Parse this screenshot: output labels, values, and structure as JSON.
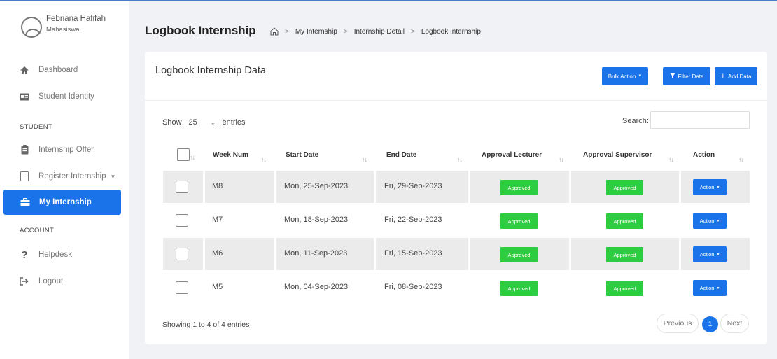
{
  "profile": {
    "name": "Febriana Hafifah",
    "role": "Mahasiswa"
  },
  "sidebar": {
    "items": [
      {
        "label": "Dashboard",
        "icon": "home-icon"
      },
      {
        "label": "Student Identity",
        "icon": "id-card-icon"
      },
      {
        "label": "Internship Offer",
        "icon": "clipboard-icon"
      },
      {
        "label": "Register Internship",
        "icon": "form-icon"
      },
      {
        "label": "My Internship",
        "icon": "briefcase-icon"
      },
      {
        "label": "Helpdesk",
        "icon": "question-icon"
      },
      {
        "label": "Logout",
        "icon": "logout-icon"
      }
    ],
    "sections": {
      "student": "STUDENT",
      "account": "ACCOUNT"
    }
  },
  "header": {
    "title": "Logbook Internship",
    "breadcrumb": [
      "My Internship",
      "Internship Detail",
      "Logbook Internship"
    ]
  },
  "card": {
    "title": "Logbook Internship Data",
    "buttons": {
      "bulk": "Bulk Action",
      "filter": "Filter Data",
      "add": "Add Data"
    },
    "show_label": "Show",
    "entries_value": "25",
    "entries_label": "entries",
    "search_label": "Search:",
    "search_value": ""
  },
  "table": {
    "headers": [
      "Week Num",
      "Start Date",
      "End Date",
      "Approval Lecturer",
      "Approval Supervisor",
      "Action"
    ],
    "rows": [
      {
        "week": "M8",
        "start": "Mon, 25-Sep-2023",
        "end": "Fri, 29-Sep-2023",
        "lecturer": "Approved",
        "supervisor": "Approved",
        "action": "Action"
      },
      {
        "week": "M7",
        "start": "Mon, 18-Sep-2023",
        "end": "Fri, 22-Sep-2023",
        "lecturer": "Approved",
        "supervisor": "Approved",
        "action": "Action"
      },
      {
        "week": "M6",
        "start": "Mon, 11-Sep-2023",
        "end": "Fri, 15-Sep-2023",
        "lecturer": "Approved",
        "supervisor": "Approved",
        "action": "Action"
      },
      {
        "week": "M5",
        "start": "Mon, 04-Sep-2023",
        "end": "Fri, 08-Sep-2023",
        "lecturer": "Approved",
        "supervisor": "Approved",
        "action": "Action"
      }
    ]
  },
  "footer": {
    "showing": "Showing 1 to 4 of 4 entries",
    "previous": "Previous",
    "page": "1",
    "next": "Next"
  },
  "colors": {
    "primary": "#1a73e8",
    "approved": "#2ecc40"
  }
}
